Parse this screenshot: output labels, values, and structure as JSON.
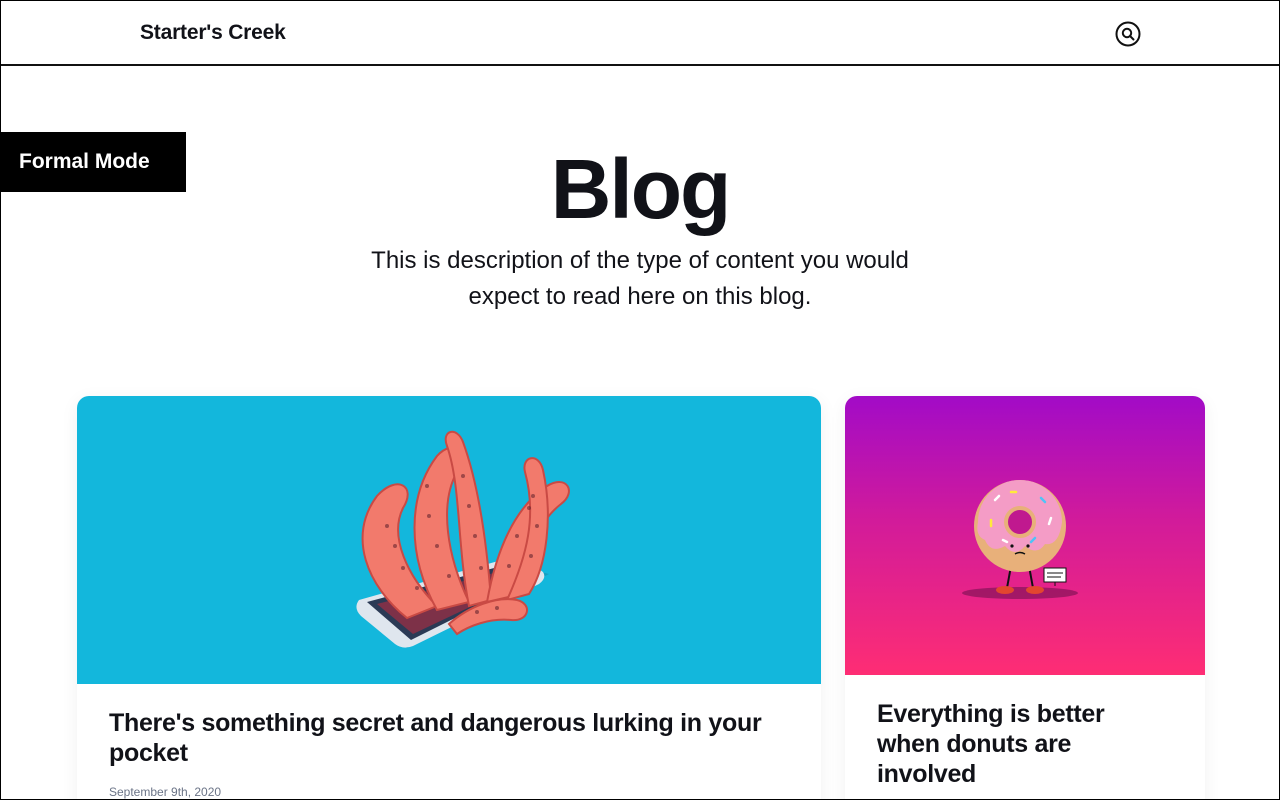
{
  "header": {
    "site_title": "Starter's Creek",
    "search_icon": "search-icon"
  },
  "badge": {
    "label": "Formal Mode"
  },
  "hero": {
    "title": "Blog",
    "description": "This is description of the type of content you would expect to read here on this blog."
  },
  "posts": [
    {
      "title": "There's something secret and dangerous lurking in your pocket",
      "date": "September 9th, 2020",
      "image_icon": "octopus-tentacles-phone-illustration",
      "image_bg": "#13b7dc"
    },
    {
      "title": "Everything is better when donuts are involved",
      "image_icon": "donut-character-illustration",
      "image_sign": "I DONUT CARE!",
      "image_bg_top": "#a20bc7",
      "image_bg_bottom": "#fe2d74"
    }
  ],
  "colors": {
    "text": "#111218",
    "muted": "#6b7487",
    "accent_blue": "#13b7dc",
    "accent_pink": "#fe2d74"
  }
}
